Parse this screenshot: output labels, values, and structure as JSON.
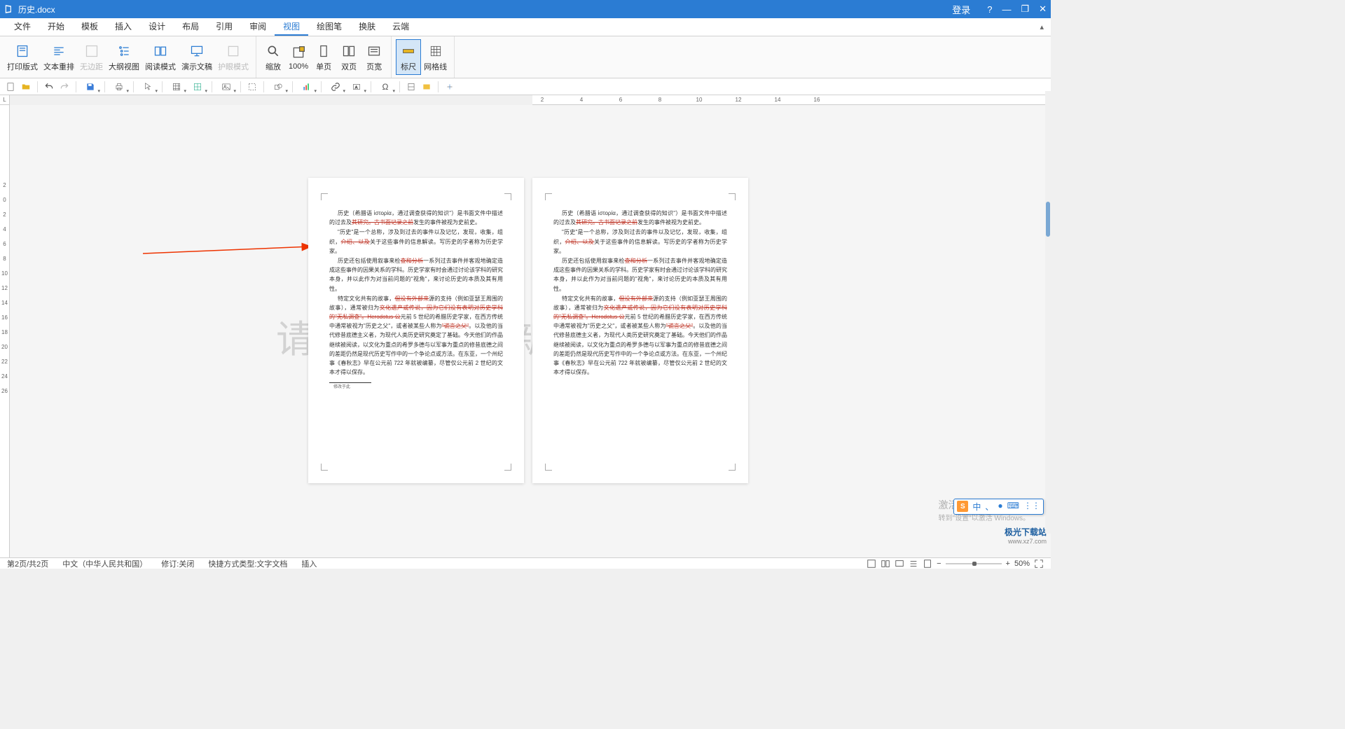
{
  "titlebar": {
    "filename": "历史.docx",
    "login": "登录",
    "help": "?",
    "minimize": "—",
    "restore": "❐",
    "close": "✕"
  },
  "menu": {
    "items": [
      "文件",
      "开始",
      "模板",
      "插入",
      "设计",
      "布局",
      "引用",
      "审阅",
      "视图",
      "绘图笔",
      "换肤",
      "云端"
    ],
    "active_index": 8
  },
  "ribbon": {
    "g1": [
      {
        "label": "打印版式"
      },
      {
        "label": "文本重排"
      },
      {
        "label": "无边距",
        "disabled": true
      },
      {
        "label": "大纲视图"
      },
      {
        "label": "阅读模式"
      },
      {
        "label": "演示文稿"
      },
      {
        "label": "护眼模式",
        "disabled": true
      }
    ],
    "g2": [
      {
        "label": "缩放"
      },
      {
        "label": "100%"
      },
      {
        "label": "单页"
      },
      {
        "label": "双页"
      },
      {
        "label": "页宽"
      }
    ],
    "g3": [
      {
        "label": "标尺",
        "active": true
      },
      {
        "label": "网格线"
      }
    ]
  },
  "hruler": [
    "2",
    "",
    "4",
    "",
    "6",
    "",
    "8",
    "",
    "10",
    "",
    "12",
    "",
    "14",
    "",
    "16"
  ],
  "vruler": [
    "2",
    "0",
    "2",
    "4",
    "6",
    "8",
    "10",
    "12",
    "14",
    "16",
    "18",
    "20",
    "22",
    "24",
    "26"
  ],
  "doc": {
    "paragraphs": [
      {
        "pre": "历史（希腊语 ἱστορία，通过调查获得的知识\"）是书面文件中描述的过去及",
        "strike": "其研究。古书面记录之前",
        "post": "发生的事件被视为史前史。"
      },
      {
        "pre": "\"历史\"是一个总称，涉及到过去的事件以及记忆，发现，收集，组织，",
        "strike": "介绍、以及",
        "post": "关于这些事件的信息解读。写历史的学者称为历史学家。"
      },
      {
        "pre": "历史还包括使用叙事来检",
        "strike": "查和分析",
        "post": "一系列过去事件并客观地确定造成这些事件的因果关系的学科。历史学家有时会通过讨论该学科的研究本身，并以此作为对当前问题的\"视角\"，来讨论历史的本质及其有用性。"
      },
      {
        "pre": "特定文化共有的故事，",
        "strike": "但没有外部来",
        "post": "源的支持（例如亚瑟王周围的故事），通常被归为",
        "strike2": "文化遗产或传说，因为它们没有表明对历史学科的\"无私调查\"。Herodotus 公",
        "post2": "元前 5 世纪的希腊历史学家，在西方传统中通常被视为\"历史之父\"，或者被某些人称为",
        "strike3": "\"谎言之父\"",
        "post3": "。以及他的当代修昔底德主义者，为现代人类历史研究奠定了基础。今天他们的作品继续被阅读，以文化为重点的希罗多德与以军事为重点的修昔底德之间的差距仍然是现代历史写作中的一个争论点或方法。在东亚，一个州纪事《春秋志》早在公元前 722 年就被编纂，尽管仅公元前 2 世纪的文本才得以保存。"
      }
    ],
    "footnote": "修改于此"
  },
  "watermark": "请更新最新版本",
  "statusbar": {
    "pages": "第2页/共2页",
    "lang": "中文（中华人民共和国）",
    "track": "修订:关闭",
    "shortcut": "快捷方式类型:文字文档",
    "insert": "插入",
    "zoom": "50%"
  },
  "activate": {
    "title": "激活 Windows",
    "sub": "转到\"设置\"以激活 Windows。"
  },
  "ime": {
    "lang": "中",
    "items": [
      "、",
      "●",
      "⌨",
      "⋮⋮"
    ]
  },
  "site": {
    "name": "极光下载站",
    "url": "www.xz7.com"
  }
}
